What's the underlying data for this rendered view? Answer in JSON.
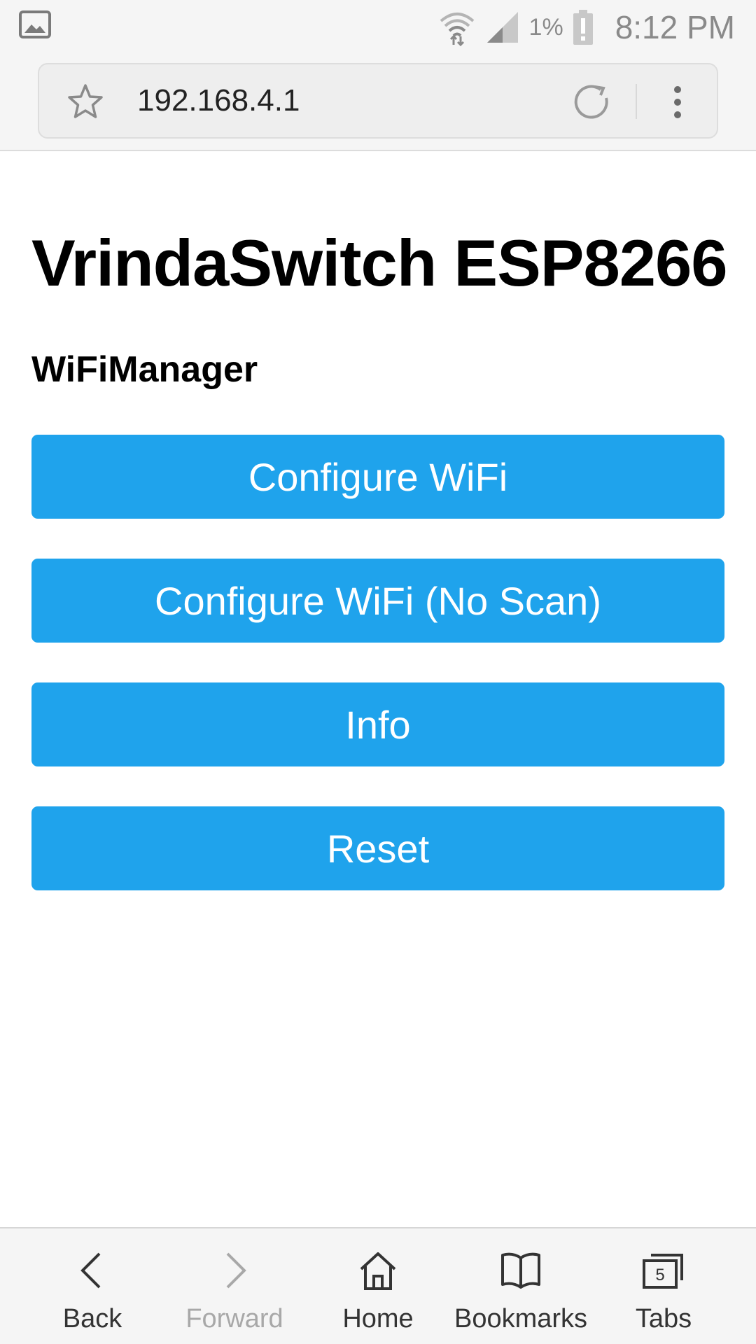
{
  "status_bar": {
    "battery_percent": "1%",
    "time": "8:12 PM",
    "icons": [
      "gallery-icon",
      "wifi-icon",
      "signal-icon",
      "battery-alert-icon"
    ]
  },
  "browser": {
    "url": "192.168.4.1",
    "icons": [
      "star-icon",
      "reload-icon",
      "more-vert-icon"
    ]
  },
  "page": {
    "title": "VrindaSwitch ESP8266",
    "subtitle": "WiFiManager",
    "buttons": [
      {
        "label": "Configure WiFi"
      },
      {
        "label": "Configure WiFi (No Scan)"
      },
      {
        "label": "Info"
      },
      {
        "label": "Reset"
      }
    ],
    "button_color": "#1fa3ec"
  },
  "bottom_nav": {
    "items": [
      {
        "label": "Back",
        "icon": "chevron-left-icon",
        "enabled": true
      },
      {
        "label": "Forward",
        "icon": "chevron-right-icon",
        "enabled": false
      },
      {
        "label": "Home",
        "icon": "home-icon",
        "enabled": true
      },
      {
        "label": "Bookmarks",
        "icon": "book-icon",
        "enabled": true
      },
      {
        "label": "Tabs",
        "icon": "tabs-icon",
        "enabled": true,
        "badge": "5"
      }
    ]
  }
}
